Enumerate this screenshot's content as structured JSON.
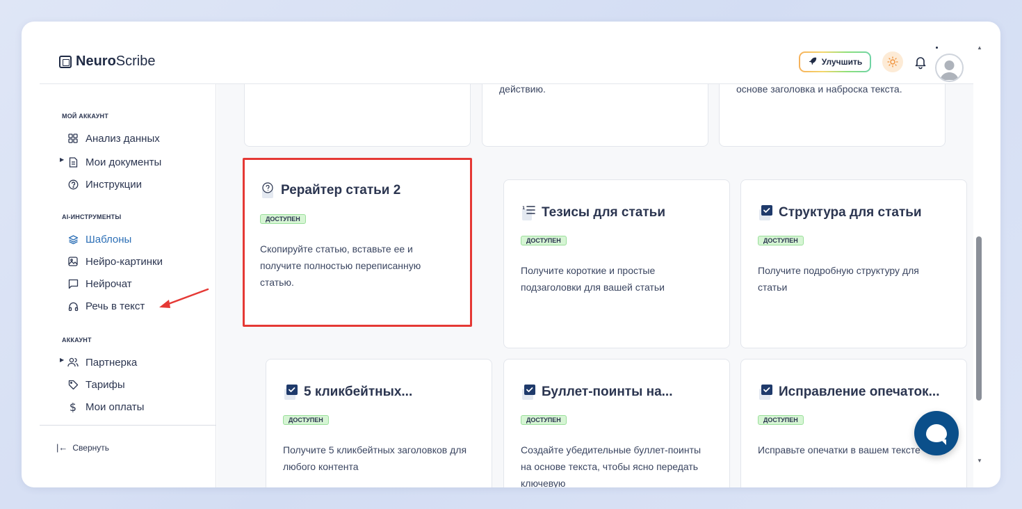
{
  "app": {
    "logo_bold": "Neuro",
    "logo_rest": "Scribe"
  },
  "header": {
    "upgrade_label": "Улучшить"
  },
  "sidebar": {
    "section_account": "МОЙ АККАУНТ",
    "section_ai": "AI-ИНСТРУМЕНТЫ",
    "section_account2": "АККАУНТ",
    "items": [
      {
        "label": "Анализ данных",
        "icon": "grid-icon"
      },
      {
        "label": "Мои документы",
        "icon": "document-icon"
      },
      {
        "label": "Инструкции",
        "icon": "help-circle-icon"
      },
      {
        "label": "Шаблоны",
        "icon": "layers-icon",
        "active": true
      },
      {
        "label": "Нейро-картинки",
        "icon": "image-icon"
      },
      {
        "label": "Нейрочат",
        "icon": "chat-icon"
      },
      {
        "label": "Речь в текст",
        "icon": "headphones-icon"
      },
      {
        "label": "Партнерка",
        "icon": "users-icon"
      },
      {
        "label": "Тарифы",
        "icon": "tag-icon"
      },
      {
        "label": "Мои оплаты",
        "icon": "dollar-icon"
      }
    ],
    "collapse_label": "Свернуть"
  },
  "cards_top_partial": [
    {
      "desc": ""
    },
    {
      "desc": "действию."
    },
    {
      "desc": "основе заголовка и наброска текста."
    }
  ],
  "cards": [
    {
      "title": "Рерайтер статьи 2",
      "badge": "ДОСТУПЕН",
      "desc": "Скопируйте статью, вставьте ее и получите полностью переписанную статью.",
      "icon": "question-doc-icon"
    },
    {
      "title": "Тезисы для статьи",
      "badge": "ДОСТУПЕН",
      "desc": "Получите короткие и простые подзаголовки для вашей статьи",
      "icon": "list-icon"
    },
    {
      "title": "Структура для статьи",
      "badge": "ДОСТУПЕН",
      "desc": "Получите подробную структуру для статьи",
      "icon": "checkbox-icon"
    },
    {
      "title": "5 кликбейтных...",
      "badge": "ДОСТУПЕН",
      "desc": "Получите 5 кликбейтных заголовков для любого контента",
      "icon": "checkbox-icon"
    },
    {
      "title": "Буллет-поинты на...",
      "badge": "ДОСТУПЕН",
      "desc": "Создайте убедительные буллет-поинты на основе текста, чтобы ясно передать ключевую",
      "icon": "checkbox-icon"
    },
    {
      "title": "Исправление опечаток...",
      "badge": "ДОСТУПЕН",
      "desc": "Исправьте опечатки в вашем тексте",
      "icon": "checkbox-icon"
    }
  ],
  "colors": {
    "accent": "#2c6fb6",
    "highlight": "#e53935",
    "badge_bg": "#d6f5d4",
    "chat_button": "#0b4f8a"
  }
}
